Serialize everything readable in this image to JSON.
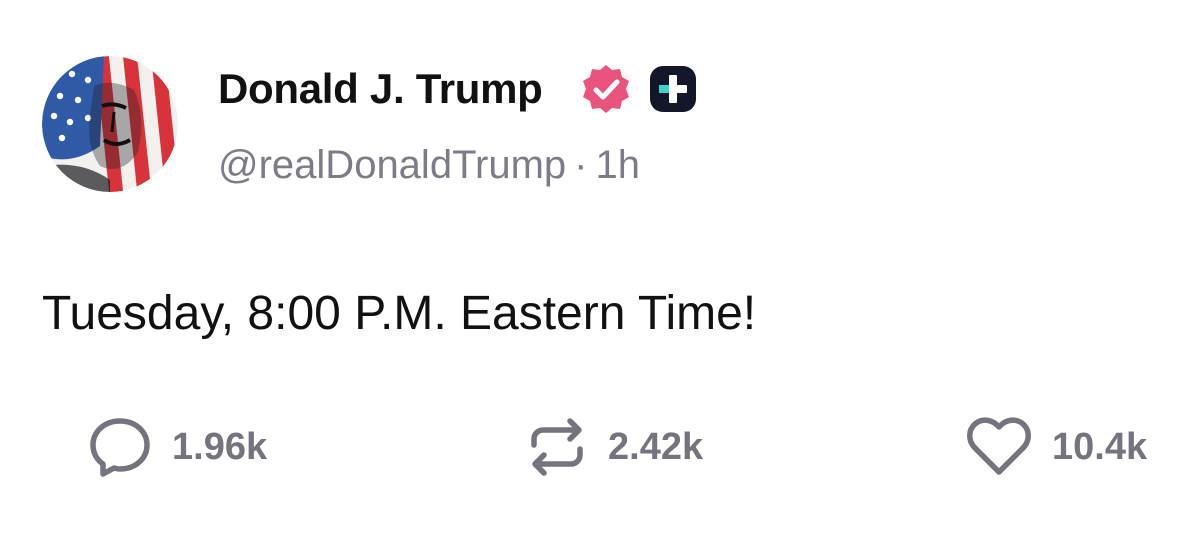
{
  "author": {
    "display_name": "Donald J. Trump",
    "handle": "@realDonaldTrump",
    "separator": "·",
    "time_ago": "1h",
    "verified_badge_color": "#e8547e",
    "plus_badge_color": "#14172a",
    "plus_badge_accent": "#3fd1c6"
  },
  "post": {
    "text": "Tuesday, 8:00 P.M. Eastern Time!"
  },
  "actions": {
    "replies": "1.96k",
    "reposts": "2.42k",
    "likes": "10.4k",
    "icon_color": "#74747e"
  }
}
